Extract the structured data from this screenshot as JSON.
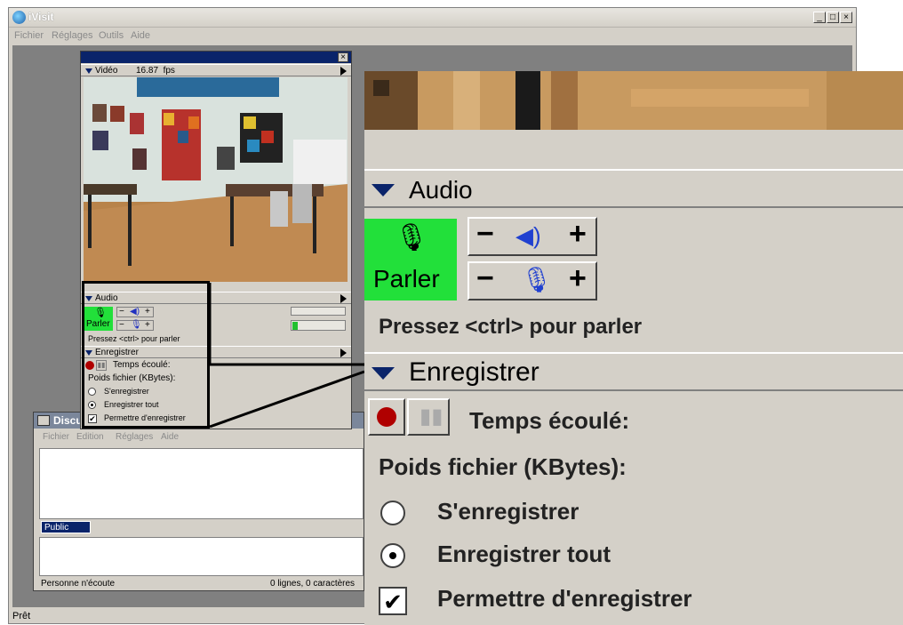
{
  "app": {
    "title": "iVisit",
    "menu": [
      "Fichier",
      "Réglages",
      "Outils",
      "Aide"
    ],
    "window_buttons": [
      "_",
      "□",
      "×"
    ],
    "status": "Prêt"
  },
  "video": {
    "label": "Vidéo",
    "fps": "16.87  fps",
    "close": "×"
  },
  "audio": {
    "label": "Audio",
    "talk_label": "Parler",
    "minus": "−",
    "plus": "+",
    "hint": "Pressez <ctrl> pour parler"
  },
  "record": {
    "label": "Enregistrer",
    "elapsed_label": "Temps écoulé:",
    "filesize_label": "Poids fichier (KBytes):",
    "options": [
      "S'enregistrer",
      "Enregistrer tout",
      "Permettre d'enregistrer"
    ],
    "selected_option": "Enregistrer tout",
    "allow_checked": true
  },
  "chat": {
    "title": "Discu",
    "menu": [
      "Fichier",
      "Edition",
      "Réglages",
      "Aide"
    ],
    "channel_tab": "Public",
    "status_left": "Personne n'écoute",
    "status_right": "0 lignes, 0 caractères"
  },
  "colors": {
    "talk_green": "#22e03a",
    "title_blue": "#0a246a",
    "record_red": "#b00000",
    "window_gray": "#d4d0c8"
  }
}
